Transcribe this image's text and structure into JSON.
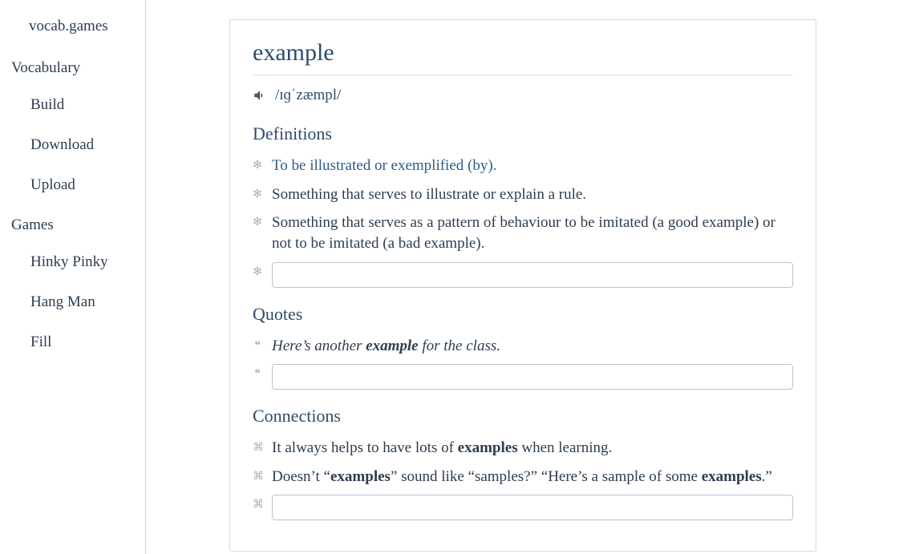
{
  "sidebar": {
    "brand": "vocab.games",
    "sections": [
      {
        "heading": "Vocabulary",
        "items": [
          "Build",
          "Download",
          "Upload"
        ]
      },
      {
        "heading": "Games",
        "items": [
          "Hinky Pinky",
          "Hang Man",
          "Fill"
        ]
      }
    ]
  },
  "word": {
    "title": "example",
    "pronunciation": "/ɪɡˈzæmpl/"
  },
  "definitions": {
    "heading": "Definitions",
    "items": [
      "To be illustrated or exemplified (by).",
      "Something that serves to illustrate or explain a rule.",
      "Something that serves as a pattern of behaviour to be imitated (a good example) or not to be imitated (a bad example)."
    ]
  },
  "quotes": {
    "heading": "Quotes",
    "items": [
      {
        "prefix": "Here’s another ",
        "bold": "example",
        "suffix": " for the class."
      }
    ]
  },
  "connections": {
    "heading": "Connections",
    "items": [
      {
        "parts": [
          {
            "t": "It always helps to have lots of "
          },
          {
            "t": "examples",
            "b": true
          },
          {
            "t": " when learning."
          }
        ]
      },
      {
        "parts": [
          {
            "t": "Doesn’t “"
          },
          {
            "t": "examples",
            "b": true
          },
          {
            "t": "” sound like “samples?” “Here’s a sample of some "
          },
          {
            "t": "examples",
            "b": true
          },
          {
            "t": ".”"
          }
        ]
      }
    ]
  }
}
